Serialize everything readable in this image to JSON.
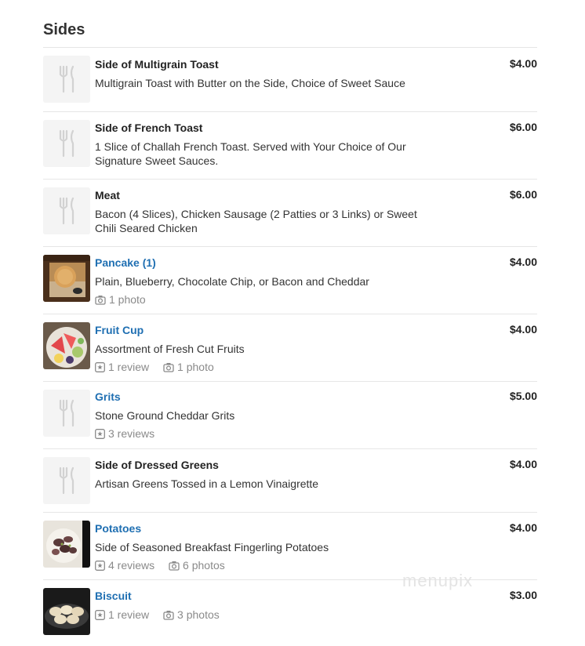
{
  "section": {
    "title": "Sides"
  },
  "items": [
    {
      "name": "Side of Multigrain Toast",
      "desc": "Multigrain Toast with Butter on the Side, Choice of Sweet Sauce",
      "price": "$4.00"
    },
    {
      "name": "Side of French Toast",
      "desc": "1 Slice of Challah French Toast. Served with Your Choice of Our Signature Sweet Sauces.",
      "price": "$6.00"
    },
    {
      "name": "Meat",
      "desc": "Bacon (4 Slices), Chicken Sausage (2 Patties or 3 Links) or Sweet Chili Seared Chicken",
      "price": "$6.00"
    },
    {
      "name": "Pancake (1)",
      "desc": "Plain, Blueberry, Chocolate Chip, or Bacon and Cheddar",
      "price": "$4.00",
      "photos": "1 photo"
    },
    {
      "name": "Fruit Cup",
      "desc": "Assortment of Fresh Cut Fruits",
      "price": "$4.00",
      "reviews": "1 review",
      "photos": "1 photo"
    },
    {
      "name": "Grits",
      "desc": "Stone Ground Cheddar Grits",
      "price": "$5.00",
      "reviews": "3 reviews"
    },
    {
      "name": "Side of Dressed Greens",
      "desc": "Artisan Greens Tossed in a Lemon Vinaigrette",
      "price": "$4.00"
    },
    {
      "name": "Potatoes",
      "desc": "Side of Seasoned Breakfast Fingerling Potatoes",
      "price": "$4.00",
      "reviews": "4 reviews",
      "photos": "6 photos"
    },
    {
      "name": "Biscuit",
      "desc": "",
      "price": "$3.00",
      "reviews": "1 review",
      "photos": "3 photos"
    }
  ],
  "watermark": "menupix",
  "colors": {
    "link": "#1f6fb2",
    "divider": "#e6e6e6",
    "meta": "#8a8a8a"
  }
}
